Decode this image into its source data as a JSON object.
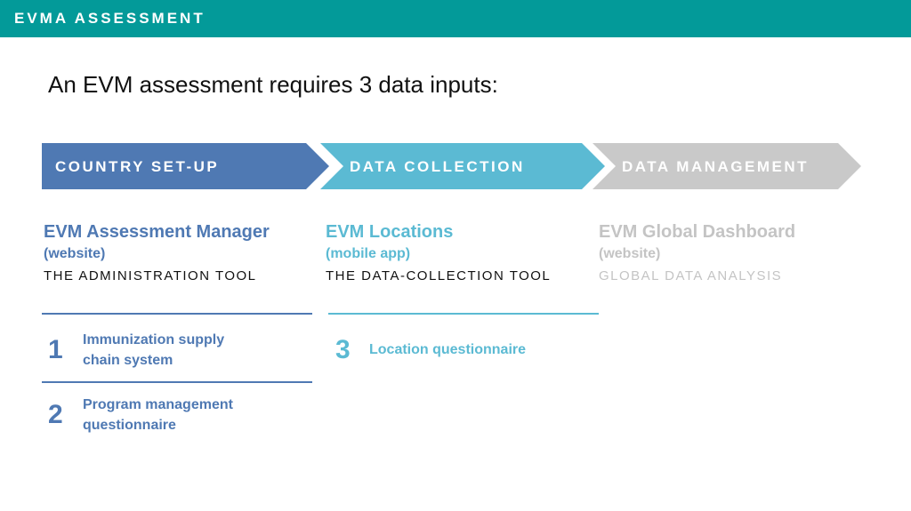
{
  "header": {
    "title": "EVMA ASSESSMENT"
  },
  "headline": "An EVM assessment requires 3 data inputs:",
  "colors": {
    "teal_bar": "#039a99",
    "stage1": "#4f79b3",
    "stage2": "#5bbad3",
    "stage3": "#c9c9c9"
  },
  "stages": [
    {
      "label": "COUNTRY SET-UP",
      "tool_name": "EVM Assessment Manager",
      "tool_type": "(website)",
      "tool_desc": "THE ADMINISTRATION TOOL"
    },
    {
      "label": "DATA COLLECTION",
      "tool_name": "EVM Locations",
      "tool_type": "(mobile app)",
      "tool_desc": "THE DATA-COLLECTION TOOL"
    },
    {
      "label": "DATA MANAGEMENT",
      "tool_name": "EVM Global Dashboard",
      "tool_type": "(website)",
      "tool_desc": "GLOBAL DATA ANALYSIS"
    }
  ],
  "inputs": [
    {
      "number": "1",
      "line1": "Immunization supply",
      "line2": "chain system"
    },
    {
      "number": "2",
      "line1": "Program management",
      "line2": "questionnaire"
    },
    {
      "number": "3",
      "line1": "Location questionnaire",
      "line2": ""
    }
  ]
}
